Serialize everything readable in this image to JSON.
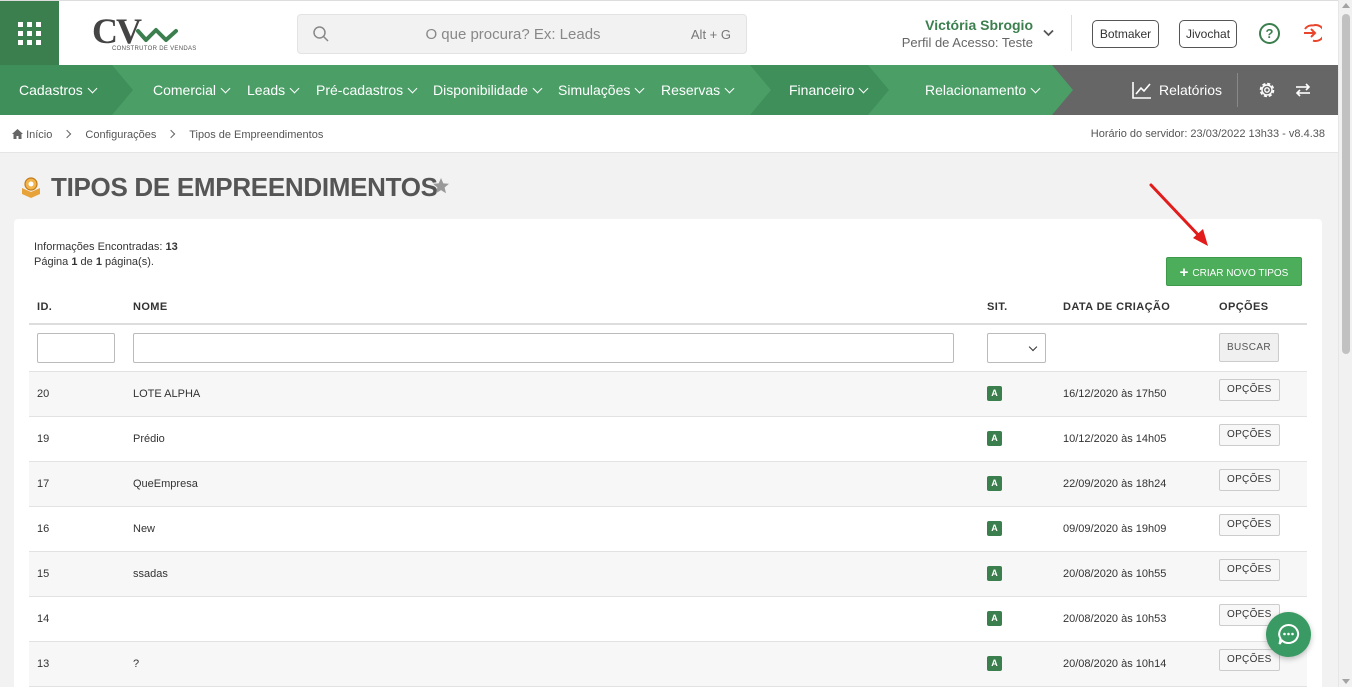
{
  "header": {
    "search_placeholder": "O que procura? Ex: Leads",
    "search_shortcut": "Alt + G",
    "user_name": "Victória Sbrogio",
    "user_profile": "Perfil de Acesso: Teste",
    "botmaker_label": "Botmaker",
    "jivochat_label": "Jivochat",
    "help_label": "?",
    "logo_text": "CV",
    "logo_tagline": "CONSTRUTOR DE VENDAS"
  },
  "nav": {
    "items": [
      {
        "label": "Cadastros"
      },
      {
        "label": "Comercial"
      },
      {
        "label": "Leads"
      },
      {
        "label": "Pré-cadastros"
      },
      {
        "label": "Disponibilidade"
      },
      {
        "label": "Simulações"
      },
      {
        "label": "Reservas"
      },
      {
        "label": "Financeiro"
      },
      {
        "label": "Relacionamento"
      }
    ],
    "reports_label": "Relatórios"
  },
  "breadcrumb": {
    "items": [
      "Início",
      "Configurações",
      "Tipos de Empreendimentos"
    ],
    "server_time": "Horário do servidor: 23/03/2022 13h33 - v8.4.38"
  },
  "page": {
    "title": "TIPOS DE EMPREENDIMENTOS",
    "info_found_label": "Informações Encontradas:",
    "info_found_count": "13",
    "page_word": "Página",
    "page_current": "1",
    "page_of": "de",
    "page_total": "1",
    "page_suffix": "página(s).",
    "create_label": "CRIAR NOVO TIPOS"
  },
  "table": {
    "headers": {
      "id": "ID.",
      "name": "NOME",
      "sit": "SIT.",
      "date": "DATA DE CRIAÇÃO",
      "options": "OPÇÕES"
    },
    "search_label": "BUSCAR",
    "options_label": "OPÇÕES",
    "rows": [
      {
        "id": "20",
        "name": "LOTE ALPHA",
        "sit": "A",
        "date": "16/12/2020 às 17h50"
      },
      {
        "id": "19",
        "name": "Prédio",
        "sit": "A",
        "date": "10/12/2020 às 14h05"
      },
      {
        "id": "17",
        "name": "QueEmpresa",
        "sit": "A",
        "date": "22/09/2020 às 18h24"
      },
      {
        "id": "16",
        "name": "New",
        "sit": "A",
        "date": "09/09/2020 às 19h09"
      },
      {
        "id": "15",
        "name": "ssadas",
        "sit": "A",
        "date": "20/08/2020 às 10h55"
      },
      {
        "id": "14",
        "name": "",
        "sit": "A",
        "date": "20/08/2020 às 10h53"
      },
      {
        "id": "13",
        "name": "?",
        "sit": "A",
        "date": "20/08/2020 às 10h14"
      }
    ]
  },
  "colors": {
    "brand_green": "#3c7f4e",
    "nav_green": "#4a9e66",
    "nav_gray": "#666666",
    "button_green": "#4cae5a",
    "logout_red": "#e8452c"
  }
}
